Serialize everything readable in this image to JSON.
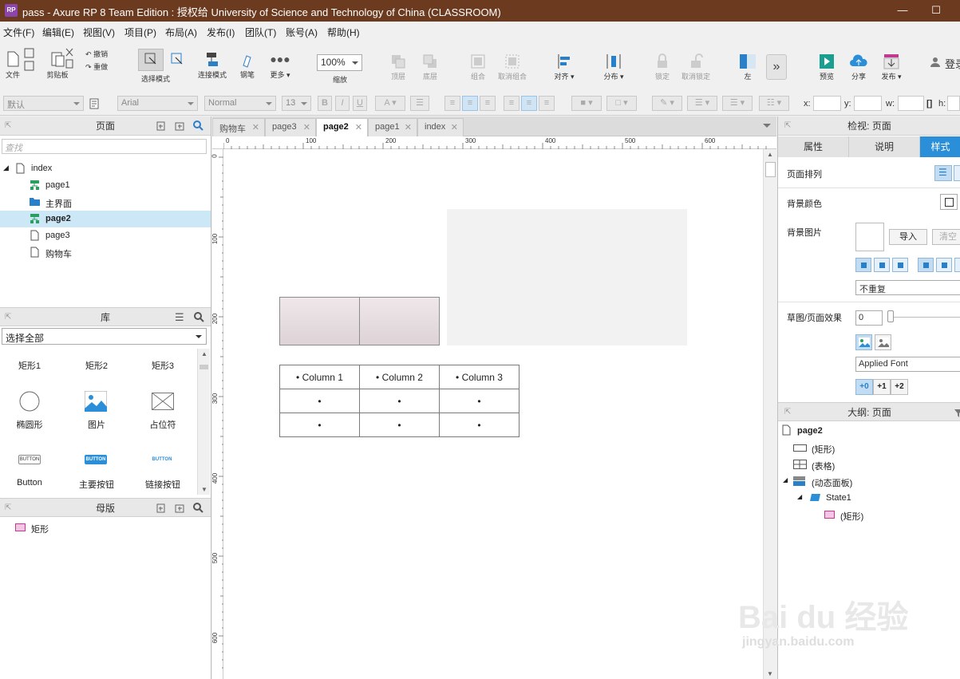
{
  "window": {
    "title": "pass - Axure RP 8 Team Edition : 授权给 University of Science and Technology of China (CLASSROOM)",
    "logo": "RP"
  },
  "menu": [
    "文件(F)",
    "编辑(E)",
    "视图(V)",
    "项目(P)",
    "布局(A)",
    "发布(I)",
    "团队(T)",
    "账号(A)",
    "帮助(H)"
  ],
  "toolbar": {
    "file": "文件",
    "clipboard": "剪贴板",
    "undo": "撤销",
    "redo": "重做",
    "select_mode": "选择模式",
    "connect_mode": "连接模式",
    "pen": "钢笔",
    "more": "更多 ▾",
    "zoom_value": "100%",
    "zoom": "缩放",
    "top_layer": "顶层",
    "bottom_layer": "底层",
    "group": "组合",
    "ungroup": "取消组合",
    "align": "对齐 ▾",
    "distribute": "分布 ▾",
    "lock": "锁定",
    "unlock": "取消锁定",
    "left": "左",
    "preview": "预览",
    "share": "分享",
    "publish": "发布 ▾",
    "login": "登录"
  },
  "format": {
    "style": "默认",
    "font": "Arial",
    "weight": "Normal",
    "size": "13",
    "x_label": "x:",
    "y_label": "y:",
    "w_label": "w:",
    "h_label": "h:"
  },
  "pages_panel": {
    "title": "页面",
    "search_placeholder": "查找",
    "items": [
      {
        "label": "index"
      },
      {
        "label": "page1"
      },
      {
        "label": "主界面"
      },
      {
        "label": "page2"
      },
      {
        "label": "page3"
      },
      {
        "label": "购物车"
      }
    ]
  },
  "library_panel": {
    "title": "库",
    "selector": "选择全部",
    "items": [
      "矩形1",
      "矩形2",
      "矩形3",
      "椭圆形",
      "图片",
      "占位符",
      "Button",
      "主要按钮",
      "链接按钮"
    ],
    "button_text": "BUTTON"
  },
  "masters_panel": {
    "title": "母版",
    "items": [
      "矩形"
    ]
  },
  "tabs": [
    "购物车",
    "page3",
    "page2",
    "page1",
    "index"
  ],
  "ruler": {
    "h": [
      "0",
      "100",
      "200",
      "300",
      "400",
      "500",
      "600"
    ],
    "v": [
      "0",
      "100",
      "200",
      "300",
      "400",
      "500",
      "600"
    ]
  },
  "canvas": {
    "table": {
      "headers": [
        "• Column 1",
        "• Column 2",
        "• Column 3"
      ],
      "rows": [
        [
          "•",
          "•",
          "•"
        ],
        [
          "•",
          "•",
          "•"
        ]
      ]
    }
  },
  "inspector": {
    "title": "检视: 页面",
    "tabs": [
      "属性",
      "说明",
      "样式"
    ],
    "page_align": "页面排列",
    "bg_color": "背景颜色",
    "bg_image": "背景图片",
    "import": "导入",
    "clear": "清空",
    "repeat": "不重复",
    "sketch": "草图/页面效果",
    "sketch_value": "0",
    "applied_font": "Applied Font",
    "font_steps": [
      "+0",
      "+1",
      "+2"
    ]
  },
  "outline": {
    "title": "大纲: 页面",
    "items": [
      "page2",
      "(矩形)",
      "(表格)",
      "(动态面板)",
      "State1",
      "(矩形)"
    ]
  },
  "watermark": {
    "brand": "Bai du 经验",
    "url": "jingyan.baidu.com"
  }
}
